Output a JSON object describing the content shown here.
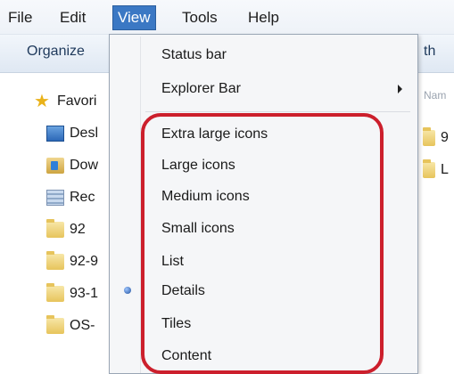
{
  "menubar": {
    "file": "File",
    "edit": "Edit",
    "view": "View",
    "tools": "Tools",
    "help": "Help"
  },
  "toolbar": {
    "organize": "Organize",
    "right_text": "th"
  },
  "nav": {
    "favorites": "Favori",
    "items": [
      "Desl",
      "Dow",
      "Rec",
      "92",
      "92-9",
      "93-1",
      "OS-"
    ]
  },
  "content": {
    "column_name": "Nam",
    "items": [
      "9",
      "L"
    ]
  },
  "view_menu": {
    "status_bar": "Status bar",
    "explorer_bar": "Explorer Bar",
    "layouts": [
      "Extra large icons",
      "Large icons",
      "Medium icons",
      "Small icons",
      "List",
      "Details",
      "Tiles",
      "Content"
    ],
    "selected_layout": "Details"
  },
  "colors": {
    "menu_active": "#3b78c4",
    "highlight_ring": "#cc1f2c"
  }
}
